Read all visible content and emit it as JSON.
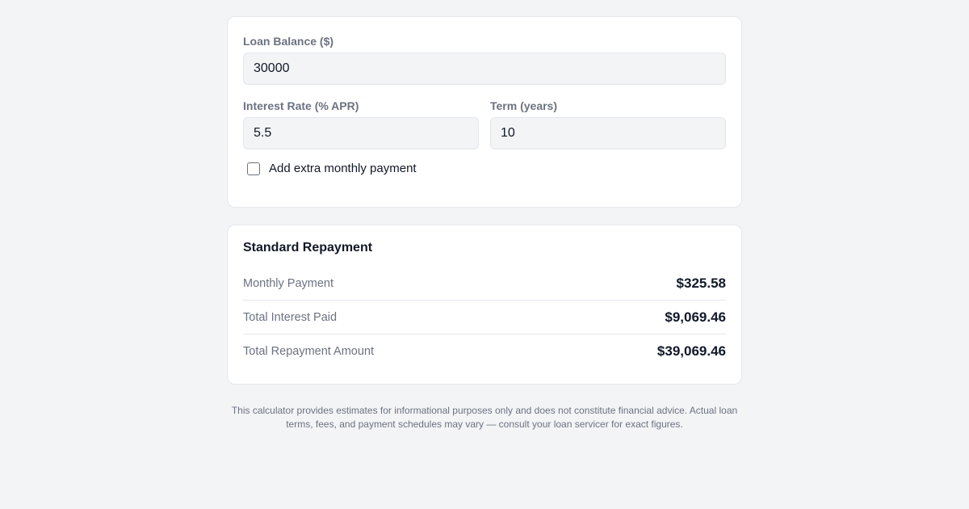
{
  "form": {
    "loan_balance_label": "Loan Balance ($)",
    "loan_balance_value": "30000",
    "interest_rate_label": "Interest Rate (% APR)",
    "interest_rate_value": "5.5",
    "term_label": "Term (years)",
    "term_value": "10",
    "extra_payment_label": "Add extra monthly payment",
    "extra_payment_checked": false
  },
  "results": {
    "title": "Standard Repayment",
    "rows": [
      {
        "label": "Monthly Payment",
        "value": "$325.58"
      },
      {
        "label": "Total Interest Paid",
        "value": "$9,069.46"
      },
      {
        "label": "Total Repayment Amount",
        "value": "$39,069.46"
      }
    ]
  },
  "disclaimer": "This calculator provides estimates for informational purposes only and does not constitute financial advice. Actual loan terms, fees, and payment schedules may vary — consult your loan servicer for exact figures.",
  "colors": {
    "background": "#f3f4f6",
    "card": "#ffffff",
    "muted_text": "#6b7280",
    "text": "#111827",
    "border": "#e5e7eb"
  }
}
